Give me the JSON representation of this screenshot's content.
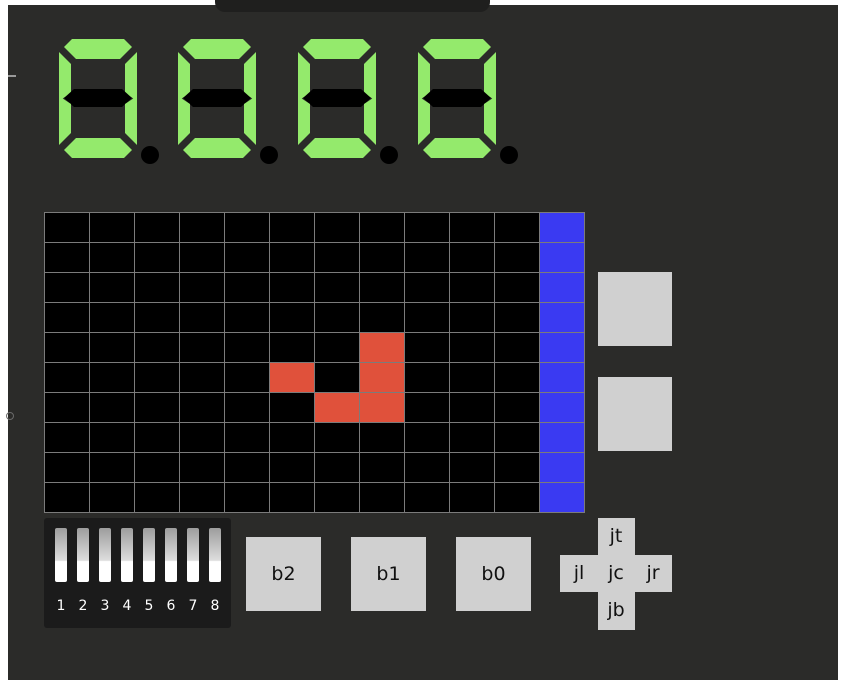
{
  "seven_segment": {
    "digits": [
      {
        "segments_on": [
          "a",
          "b",
          "c",
          "d",
          "e",
          "f"
        ],
        "dp": false
      },
      {
        "segments_on": [
          "a",
          "b",
          "c",
          "d",
          "e",
          "f"
        ],
        "dp": false
      },
      {
        "segments_on": [
          "a",
          "b",
          "c",
          "d",
          "e",
          "f"
        ],
        "dp": false
      },
      {
        "segments_on": [
          "a",
          "b",
          "c",
          "d",
          "e",
          "f"
        ],
        "dp": false
      }
    ],
    "on_color": "#94ea6c",
    "off_color": "#000000"
  },
  "led_matrix": {
    "rows": 10,
    "cols": 11,
    "lit_cells": [
      [
        4,
        7
      ],
      [
        5,
        5
      ],
      [
        5,
        7
      ],
      [
        6,
        6
      ],
      [
        6,
        7
      ]
    ],
    "lit_color": "#e0513b",
    "off_color": "#000000",
    "side_bar_color": "#3a3af2"
  },
  "buttons": {
    "b2": "b2",
    "b1": "b1",
    "b0": "b0"
  },
  "dip_switches": {
    "labels": [
      "1",
      "2",
      "3",
      "4",
      "5",
      "6",
      "7",
      "8"
    ]
  },
  "joystick": {
    "top": "jt",
    "left": "jl",
    "center": "jc",
    "right": "jr",
    "bottom": "jb"
  }
}
